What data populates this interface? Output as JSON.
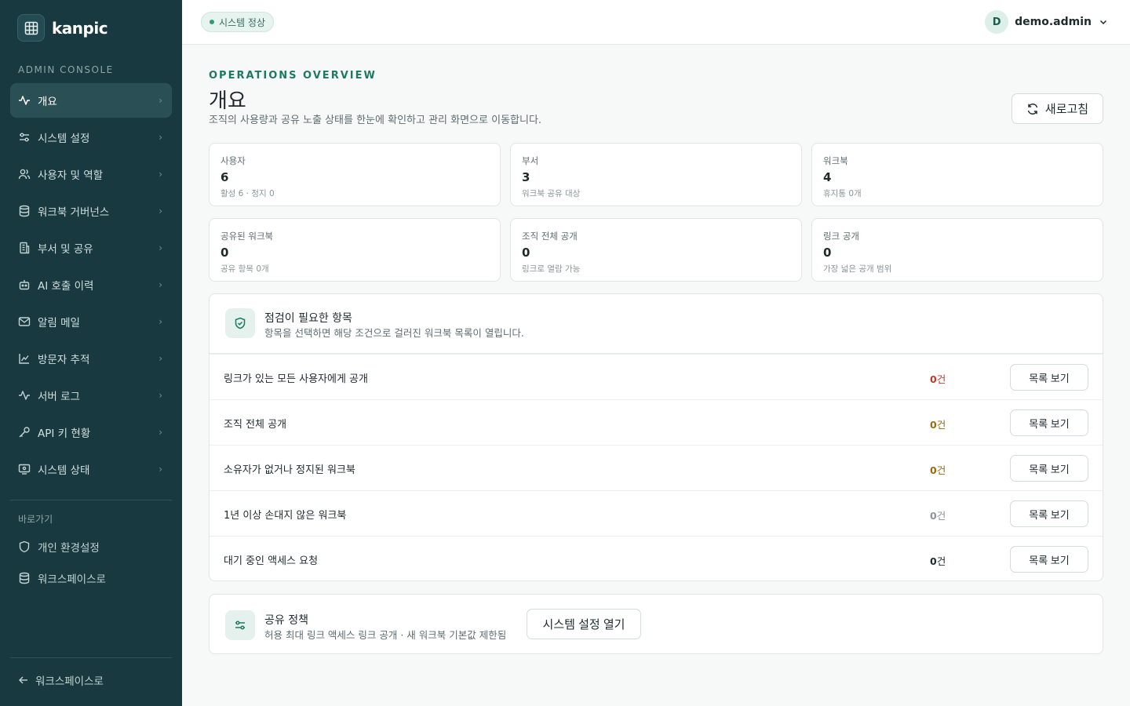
{
  "brand": {
    "name": "kanpic"
  },
  "sidebar": {
    "section_label": "ADMIN CONSOLE",
    "items": [
      {
        "label": "개요",
        "icon": "activity-icon"
      },
      {
        "label": "시스템 설정",
        "icon": "sliders-icon"
      },
      {
        "label": "사용자 및 역할",
        "icon": "users-icon"
      },
      {
        "label": "워크북 거버넌스",
        "icon": "database-icon"
      },
      {
        "label": "부서 및 공유",
        "icon": "building-icon"
      },
      {
        "label": "AI 호출 이력",
        "icon": "bot-icon"
      },
      {
        "label": "알림 메일",
        "icon": "mail-icon"
      },
      {
        "label": "방문자 추적",
        "icon": "line-chart-icon"
      },
      {
        "label": "서버 로그",
        "icon": "pulse-icon"
      },
      {
        "label": "API 키 현황",
        "icon": "key-icon"
      },
      {
        "label": "시스템 상태",
        "icon": "monitor-icon"
      }
    ],
    "quick_label": "바로가기",
    "quick_items": [
      {
        "label": "개인 환경설정",
        "icon": "shield-icon"
      },
      {
        "label": "워크스페이스로",
        "icon": "database-icon"
      }
    ],
    "back_label": "워크스페이스로"
  },
  "topbar": {
    "status": "시스템 정상",
    "user_initial": "D",
    "user_name": "demo.admin"
  },
  "main": {
    "eyebrow": "OPERATIONS OVERVIEW",
    "title": "개요",
    "description": "조직의 사용량과 공유 노출 상태를 한눈에 확인하고 관리 화면으로 이동합니다.",
    "refresh_label": "새로고침",
    "stats": [
      {
        "label": "사용자",
        "value": "6",
        "sub": "활성 6 · 정지 0"
      },
      {
        "label": "부서",
        "value": "3",
        "sub": "워크북 공유 대상"
      },
      {
        "label": "워크북",
        "value": "4",
        "sub": "휴지통 0개"
      },
      {
        "label": "공유된 워크북",
        "value": "0",
        "sub": "공유 항목 0개"
      },
      {
        "label": "조직 전체 공개",
        "value": "0",
        "sub": "링크로 열람 가능"
      },
      {
        "label": "링크 공개",
        "value": "0",
        "sub": "가장 넓은 공개 범위"
      }
    ],
    "checks": {
      "title": "점검이 필요한 항목",
      "description": "항목을 선택하면 해당 조건으로 걸러진 워크북 목록이 열립니다.",
      "button_label": "목록 보기",
      "rows": [
        {
          "label": "링크가 있는 모든 사용자에게 공개",
          "count": "0",
          "unit": "건",
          "color": "#c0392b"
        },
        {
          "label": "조직 전체 공개",
          "count": "0",
          "unit": "건",
          "color": "#9a6a10"
        },
        {
          "label": "소유자가 없거나 정지된 워크북",
          "count": "0",
          "unit": "건",
          "color": "#9a6a10"
        },
        {
          "label": "1년 이상 손대지 않은 워크북",
          "count": "0",
          "unit": "건",
          "color": "#8b9598"
        },
        {
          "label": "대기 중인 액세스 요청",
          "count": "0",
          "unit": "건",
          "color": "#1f2a2e"
        }
      ]
    },
    "policy": {
      "title": "공유 정책",
      "description": "허용 최대 링크 액세스 링크 공개 · 새 워크북 기본값 제한됨",
      "button_label": "시스템 설정 열기"
    }
  },
  "colors": {
    "sidebar_bg": "#17393f",
    "accent": "#1d7a62",
    "danger": "#c0392b",
    "warning": "#9a6a10"
  }
}
